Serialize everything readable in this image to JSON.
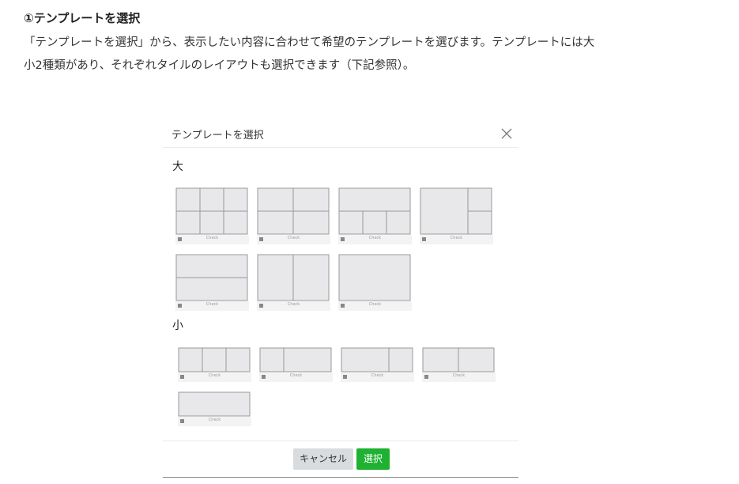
{
  "article": {
    "heading": "①テンプレートを選択",
    "description_lines": [
      "「テンプレートを選択」から、表示したい内容に合わせて希望のテンプレートを選びます。テンプレートには大",
      "小2種類があり、それぞれタイルのレイアウトも選択できます（下記参照）。"
    ]
  },
  "dialog": {
    "title": "テンプレートを選択",
    "close_icon": "close-icon",
    "large_label": "大",
    "small_label": "小",
    "tile_caption": "Check",
    "cancel_label": "キャンセル",
    "select_label": "選択"
  }
}
